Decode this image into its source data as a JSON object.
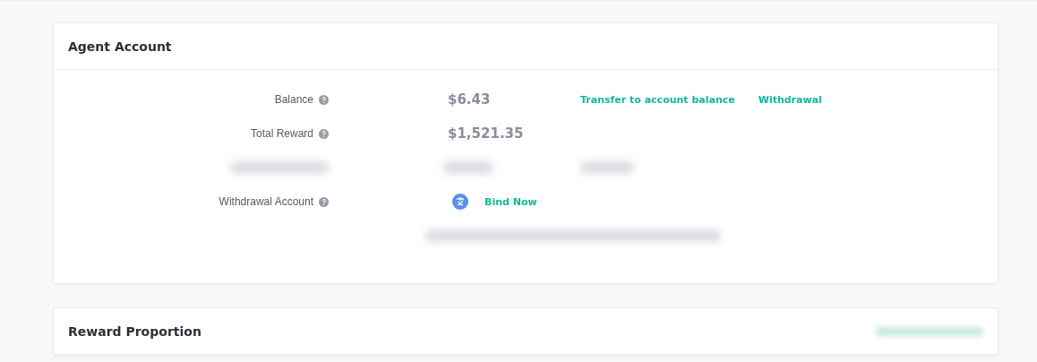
{
  "agent_account": {
    "title": "Agent Account",
    "rows": [
      {
        "kind": "amount",
        "label": "Balance",
        "value": "$6.43",
        "actions": [
          "Transfer to account balance",
          "Withdrawal"
        ]
      },
      {
        "kind": "amount",
        "label": "Total Reward",
        "value": "$1,521.35",
        "actions": []
      },
      {
        "kind": "blurred"
      },
      {
        "kind": "bind",
        "label": "Withdrawal Account",
        "action": "Bind Now"
      },
      {
        "kind": "blurred-note"
      }
    ]
  },
  "reward_proportion": {
    "title": "Reward Proportion"
  }
}
